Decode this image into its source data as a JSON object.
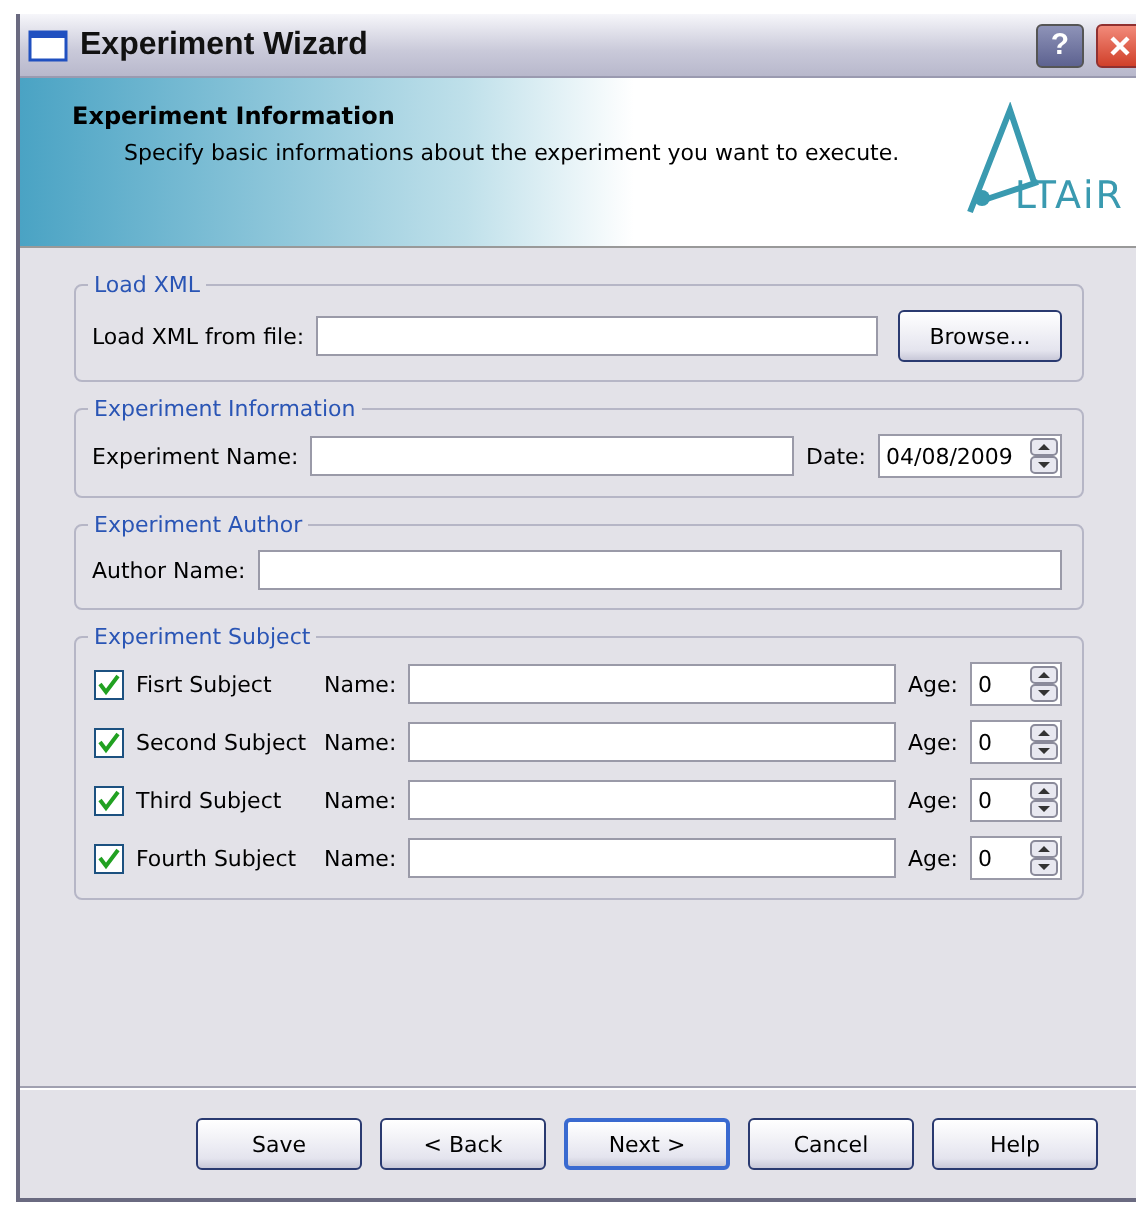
{
  "window": {
    "title": "Experiment Wizard",
    "help_button": "?"
  },
  "header": {
    "title": "Experiment Information",
    "subtitle": "Specify basic informations about the experiment you want to execute.",
    "logo_text": "LTAiR"
  },
  "groups": [
    {
      "kind": "file",
      "title": "Load XML",
      "label": "Load XML from file:",
      "button": "Browse..."
    },
    {
      "kind": "info",
      "title": "Experiment Information",
      "label": "Experiment Name:",
      "date_label": "Date:",
      "date": "04/08/2009"
    },
    {
      "kind": "author",
      "title": "Experiment Author",
      "label": "Author Name:"
    },
    {
      "kind": "subjects",
      "title": "Experiment Subject",
      "subjects": [
        {
          "label": "Fisrt Subject",
          "checked": true,
          "name_label": "Name:",
          "age_label": "Age:",
          "age": "0"
        },
        {
          "label": "Second Subject",
          "checked": true,
          "name_label": "Name:",
          "age_label": "Age:",
          "age": "0"
        },
        {
          "label": "Third Subject",
          "checked": true,
          "name_label": "Name:",
          "age_label": "Age:",
          "age": "0"
        },
        {
          "label": "Fourth Subject",
          "checked": true,
          "name_label": "Name:",
          "age_label": "Age:",
          "age": "0"
        }
      ]
    }
  ],
  "buttons": [
    {
      "label": "Save",
      "default": false
    },
    {
      "label": "< Back",
      "default": false
    },
    {
      "label": "Next >",
      "default": true
    },
    {
      "label": "Cancel",
      "default": false
    },
    {
      "label": "Help",
      "default": false
    }
  ]
}
